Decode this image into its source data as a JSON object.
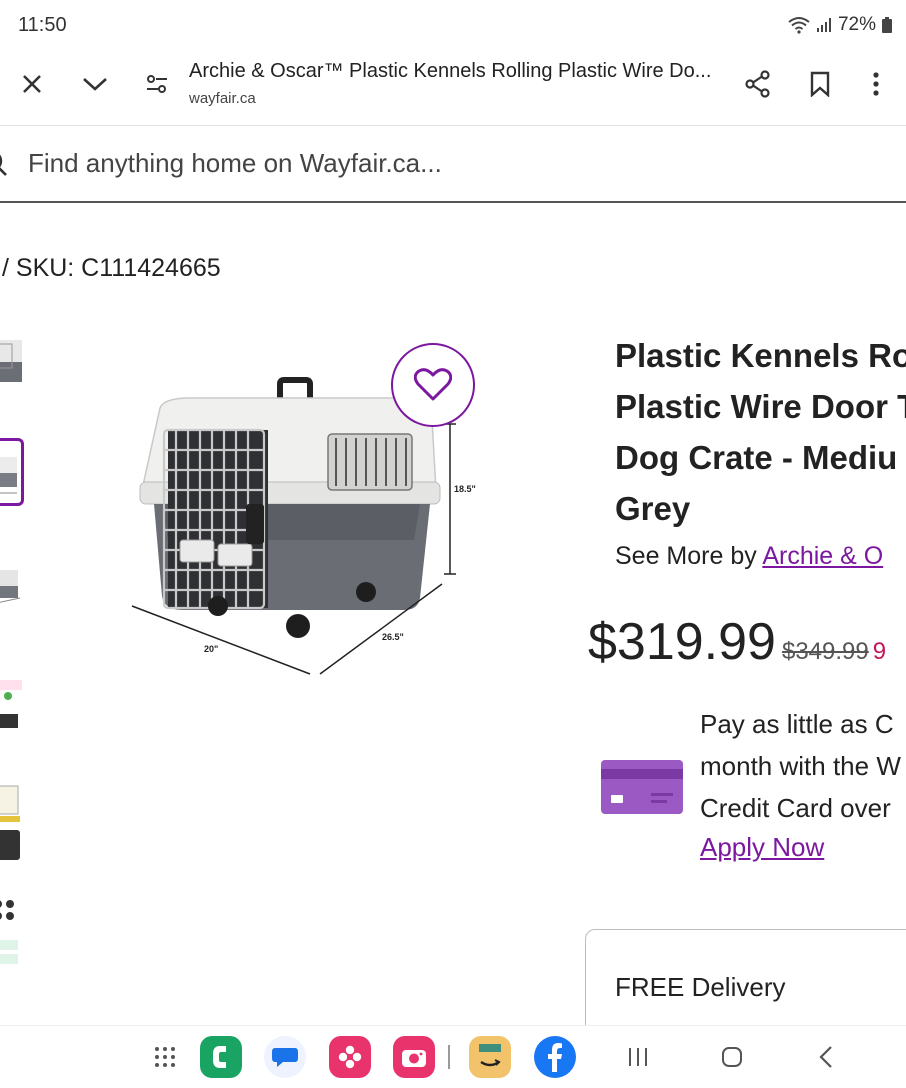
{
  "status": {
    "time": "11:50",
    "battery": "72%"
  },
  "browser": {
    "tab_title": "Archie & Oscar™ Plastic Kennels Rolling Plastic Wire Do...",
    "domain": "wayfair.ca"
  },
  "search": {
    "placeholder": "Find anything home on Wayfair.ca..."
  },
  "breadcrumb": {
    "sku": "/  SKU: C111424665"
  },
  "product": {
    "title": "Plastic Kennels Ro\nPlastic Wire Door T\nDog Crate - Mediu\nGrey",
    "see_more_prefix": "See More by ",
    "brand_link": "Archie & O",
    "price": "$319.99",
    "old_price": "$349.99",
    "discount": "9"
  },
  "image": {
    "dim_height": "18.5\"",
    "dim_width": "20\"",
    "dim_depth": "26.5\""
  },
  "financing": {
    "text": "Pay as little as C\nmonth with the W\nCredit Card over",
    "apply_label": "Apply Now"
  },
  "delivery": {
    "label": "FREE Delivery"
  },
  "colors": {
    "accent": "#7b189f",
    "discount": "#c2185b"
  }
}
